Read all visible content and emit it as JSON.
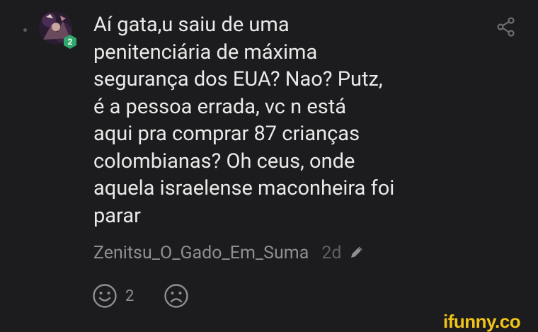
{
  "comment": {
    "author_level": "2",
    "text": "Aí gata,u saiu de uma\npenitenciária de máxima\nsegurança dos EUA? Nao? Putz,\né a pessoa errada, vc n está\naqui pra comprar 87 crianças\ncolombianas? Oh ceus, onde\naquela israelense maconheira foi\nparar",
    "author": "Zenitsu_O_Gado_Em_Suma",
    "age": "2d",
    "smile_count": "2"
  },
  "icons": {
    "share": "share-icon",
    "edit": "pencil-icon",
    "smile": "smile-reaction-icon",
    "frown": "frown-reaction-icon"
  },
  "colors": {
    "background": "#1c1c1e",
    "badge": "#2ea86b",
    "watermark": "#f0c419"
  },
  "watermark": "ifunny.co"
}
